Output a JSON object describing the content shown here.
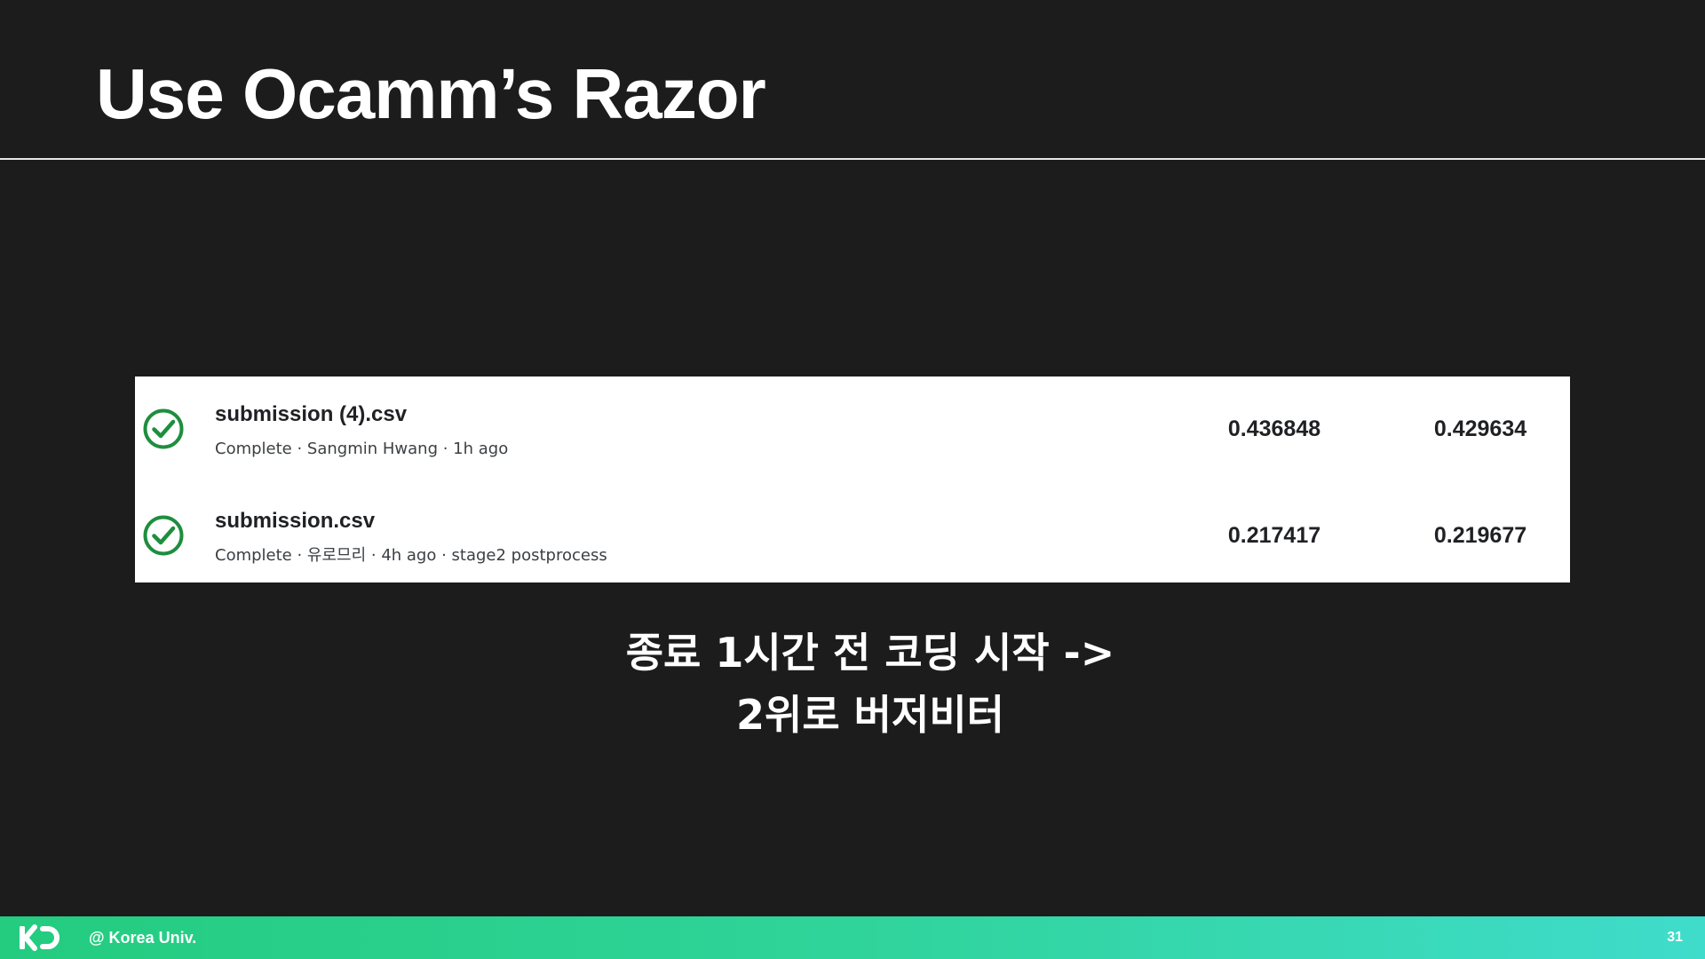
{
  "slide": {
    "title": "Use Ocamm’s Razor",
    "page_number": "31"
  },
  "submissions": [
    {
      "filename": "submission (4).csv",
      "meta": "Complete · Sangmin Hwang · 1h ago",
      "status_icon": "check-circle-icon",
      "private_score": "0.436848",
      "public_score": "0.429634"
    },
    {
      "filename": "submission.csv",
      "meta": "Complete · 유로므리 · 4h ago · stage2 postprocess",
      "status_icon": "check-circle-icon",
      "private_score": "0.217417",
      "public_score": "0.219677"
    }
  ],
  "caption": {
    "line1": "종료 1시간 전 코딩 시작 ->",
    "line2": "2위로 버저비터"
  },
  "footer": {
    "logo_icon": "kd-logo-icon",
    "org": "@ Korea Univ."
  },
  "colors": {
    "background": "#1c1c1d",
    "check_green": "#1e8e3e",
    "footer_gradient_start": "#23cc7f",
    "footer_gradient_end": "#3fdccb"
  }
}
